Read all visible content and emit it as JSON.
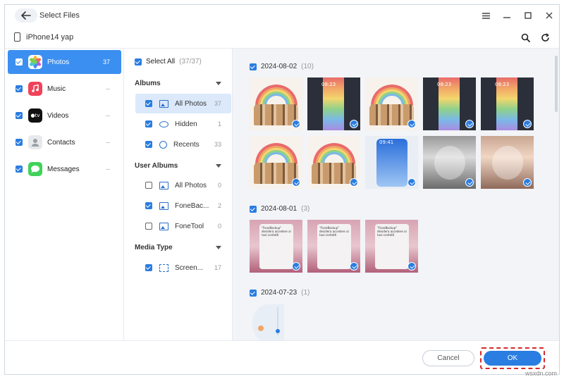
{
  "window": {
    "title": "Select Files",
    "device_name": "iPhone14 yap"
  },
  "categories": [
    {
      "label": "Photos",
      "count": "37",
      "icon": "photos-icon",
      "checked": true,
      "active": true
    },
    {
      "label": "Music",
      "count": "--",
      "icon": "music-icon",
      "checked": true
    },
    {
      "label": "Videos",
      "count": "--",
      "icon": "tv-icon",
      "checked": true
    },
    {
      "label": "Contacts",
      "count": "--",
      "icon": "contacts-icon",
      "checked": true
    },
    {
      "label": "Messages",
      "count": "--",
      "icon": "messages-icon",
      "checked": true
    }
  ],
  "filters": {
    "select_all_label": "Select All",
    "select_all_count": "(37/37)",
    "albums_header": "Albums",
    "albums": [
      {
        "label": "All Photos",
        "count": "37",
        "checked": true,
        "active": true
      },
      {
        "label": "Hidden",
        "count": "1",
        "checked": true
      },
      {
        "label": "Recents",
        "count": "33",
        "checked": true
      }
    ],
    "user_albums_header": "User Albums",
    "user_albums": [
      {
        "label": "All Photos",
        "count": "0",
        "checked": false
      },
      {
        "label": "FoneBac...",
        "count": "2",
        "checked": true
      },
      {
        "label": "FoneTool",
        "count": "0",
        "checked": false
      }
    ],
    "media_type_header": "Media Type",
    "media_types": [
      {
        "label": "Screen...",
        "count": "17",
        "checked": true
      }
    ]
  },
  "groups": [
    {
      "date": "2024-08-02",
      "count": "(10)"
    },
    {
      "date": "2024-08-01",
      "count": "(3)"
    },
    {
      "date": "2024-07-23",
      "count": "(1)"
    }
  ],
  "thumb_text": {
    "lock_time": "08:23",
    "ios_time": "09:41",
    "dialog_title": "\"FoneBackup\" desidera accedere ai tuoi contatti"
  },
  "footer": {
    "cancel_label": "Cancel",
    "ok_label": "OK"
  },
  "watermark": "wsxdn.com",
  "colors": {
    "accent": "#2a7de1",
    "active_category": "#3b8ff0",
    "highlight_border": "#d62a2a"
  }
}
